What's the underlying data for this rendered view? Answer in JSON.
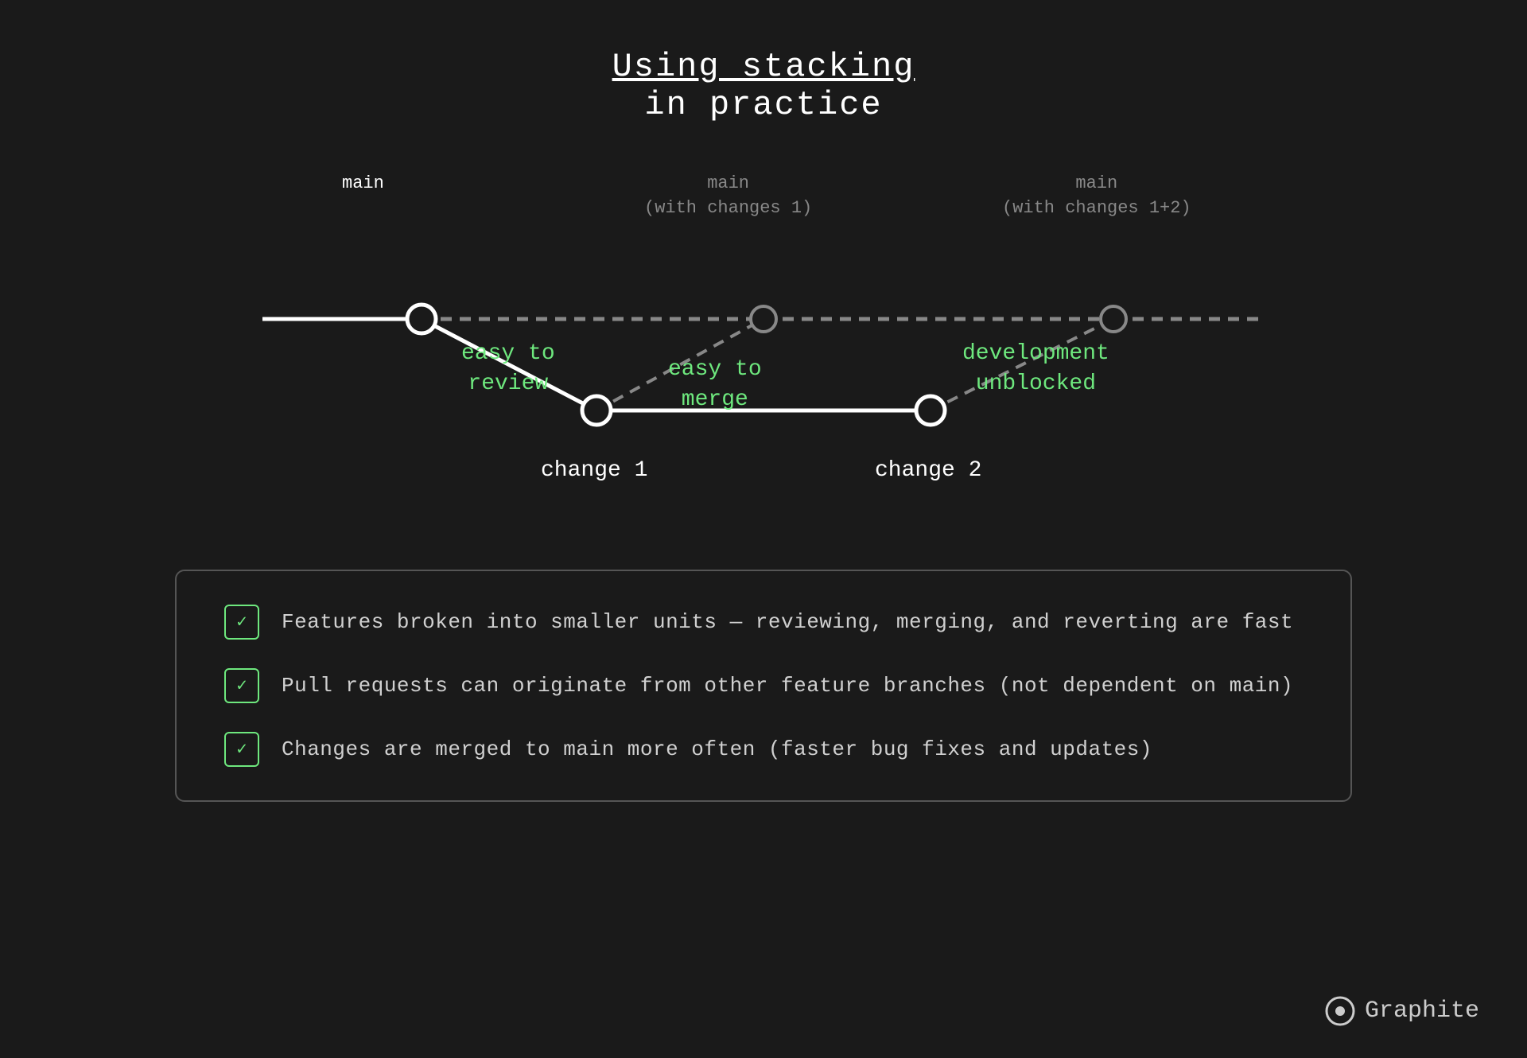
{
  "title": {
    "line1": "Using stacking",
    "line2": "in practice"
  },
  "diagram": {
    "labels": {
      "main": "main",
      "main_c1_line1": "main",
      "main_c1_line2": "(with changes 1)",
      "main_c12_line1": "main",
      "main_c12_line2": "(with changes 1+2)"
    },
    "annotations": {
      "easy_review_line1": "easy to",
      "easy_review_line2": "review",
      "easy_merge_line1": "easy to",
      "easy_merge_line2": "merge",
      "dev_unblocked_line1": "development",
      "dev_unblocked_line2": "unblocked"
    },
    "nodes": {
      "change1": "change 1",
      "change2": "change 2"
    }
  },
  "checklist": {
    "items": [
      {
        "id": "item1",
        "text": "Features broken into smaller units — reviewing, merging, and reverting are fast"
      },
      {
        "id": "item2",
        "text": "Pull requests can originate from other feature branches (not dependent on main)"
      },
      {
        "id": "item3",
        "text": "Changes are merged to main more often (faster bug fixes and updates)"
      }
    ]
  },
  "brand": {
    "name": "Graphite"
  }
}
